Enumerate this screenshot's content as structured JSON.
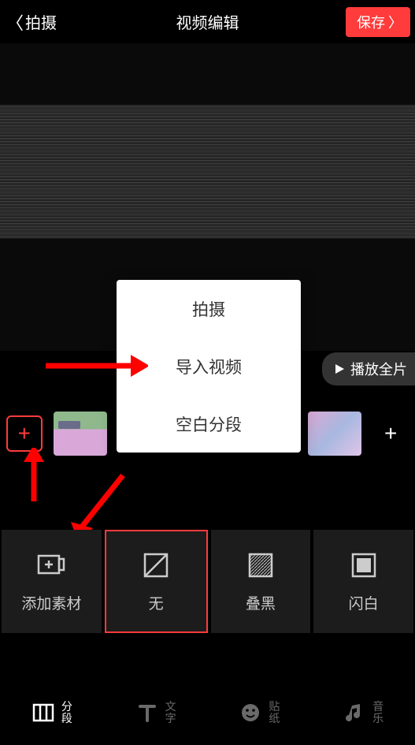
{
  "header": {
    "back_label": "拍摄",
    "title": "视频编辑",
    "save_label": "保存"
  },
  "play_full_label": "播放全片",
  "menu": {
    "items": [
      "拍摄",
      "导入视频",
      "空白分段"
    ]
  },
  "effects": {
    "add_label": "添加素材",
    "none_label": "无",
    "overlay_black_label": "叠黑",
    "flash_white_label": "闪白"
  },
  "nav": {
    "segment_a": "分",
    "segment_b": "段",
    "text_a": "文",
    "text_b": "字",
    "sticker_a": "贴",
    "sticker_b": "纸",
    "music_a": "音",
    "music_b": "乐"
  }
}
